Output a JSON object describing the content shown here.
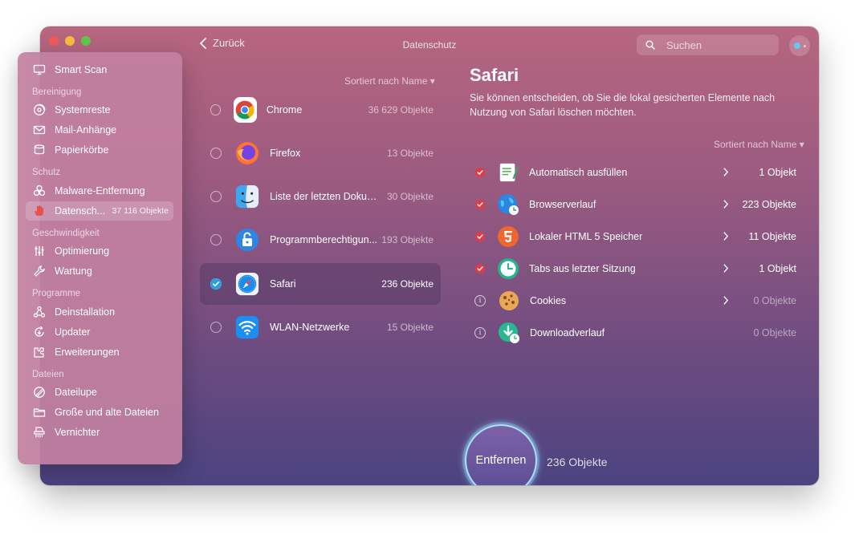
{
  "window": {
    "title": "Datenschutz",
    "back_label": "Zurück"
  },
  "search": {
    "placeholder": "Suchen"
  },
  "sidebar": {
    "top_item": {
      "label": "Smart Scan",
      "icon": "monitor-icon"
    },
    "sections": [
      {
        "title": "Bereinigung",
        "items": [
          {
            "label": "Systemreste",
            "icon": "disc-icon"
          },
          {
            "label": "Mail-Anhänge",
            "icon": "envelope-icon"
          },
          {
            "label": "Papierkörbe",
            "icon": "trash-icon"
          }
        ]
      },
      {
        "title": "Schutz",
        "items": [
          {
            "label": "Malware-Entfernung",
            "icon": "biohazard-icon"
          },
          {
            "label": "Datensch...",
            "icon": "hand-icon",
            "count": "37 116 Objekte",
            "active": true
          }
        ]
      },
      {
        "title": "Geschwindigkeit",
        "items": [
          {
            "label": "Optimierung",
            "icon": "sliders-icon"
          },
          {
            "label": "Wartung",
            "icon": "wrench-icon"
          }
        ]
      },
      {
        "title": "Programme",
        "items": [
          {
            "label": "Deinstallation",
            "icon": "nodes-icon"
          },
          {
            "label": "Updater",
            "icon": "update-icon"
          },
          {
            "label": "Erweiterungen",
            "icon": "extension-icon"
          }
        ]
      },
      {
        "title": "Dateien",
        "items": [
          {
            "label": "Dateilupe",
            "icon": "lens-icon"
          },
          {
            "label": "Große und alte Dateien",
            "icon": "folder-icon"
          },
          {
            "label": "Vernichter",
            "icon": "shredder-icon"
          }
        ]
      }
    ]
  },
  "app_list": {
    "sort_label": "Sortiert nach Name ▾",
    "apps": [
      {
        "name": "Chrome",
        "count": "36 629 Objekte",
        "icon": "chrome-icon",
        "selected": false
      },
      {
        "name": "Firefox",
        "count": "13 Objekte",
        "icon": "firefox-icon",
        "selected": false
      },
      {
        "name": "Liste der letzten Dokum...",
        "count": "30 Objekte",
        "icon": "finder-icon",
        "selected": false
      },
      {
        "name": "Programmberechtigun...",
        "count": "193 Objekte",
        "icon": "permissions-lock-icon",
        "selected": false
      },
      {
        "name": "Safari",
        "count": "236 Objekte",
        "icon": "safari-icon",
        "selected": true
      },
      {
        "name": "WLAN-Netzwerke",
        "count": "15 Objekte",
        "icon": "wifi-icon",
        "selected": false
      }
    ]
  },
  "detail": {
    "title": "Safari",
    "description": "Sie können entscheiden, ob Sie die lokal gesicherten Elemente nach Nutzung von Safari löschen möchten.",
    "sort_label": "Sortiert nach Name ▾",
    "items": [
      {
        "label": "Automatisch ausfüllen",
        "count": "1 Objekt",
        "checked": true,
        "chevron": true,
        "icon": "autofill-icon"
      },
      {
        "label": "Browserverlauf",
        "count": "223 Objekte",
        "checked": true,
        "chevron": true,
        "icon": "globe-clock-icon"
      },
      {
        "label": "Lokaler HTML 5 Speicher",
        "count": "11 Objekte",
        "checked": true,
        "chevron": true,
        "icon": "html5-icon"
      },
      {
        "label": "Tabs aus letzter Sitzung",
        "count": "1 Objekt",
        "checked": true,
        "chevron": true,
        "icon": "clock-icon"
      },
      {
        "label": "Cookies",
        "count": "0 Objekte",
        "checked": false,
        "chevron": true,
        "icon": "cookie-icon"
      },
      {
        "label": "Downloadverlauf",
        "count": "0 Objekte",
        "checked": false,
        "chevron": false,
        "icon": "download-icon"
      }
    ]
  },
  "action": {
    "remove_label": "Entfernen",
    "remove_count": "236 Objekte"
  },
  "colors": {
    "accent_check": "#e23a48",
    "selected_check": "#2f9ee0",
    "button_glow": "#a7e2f7"
  }
}
